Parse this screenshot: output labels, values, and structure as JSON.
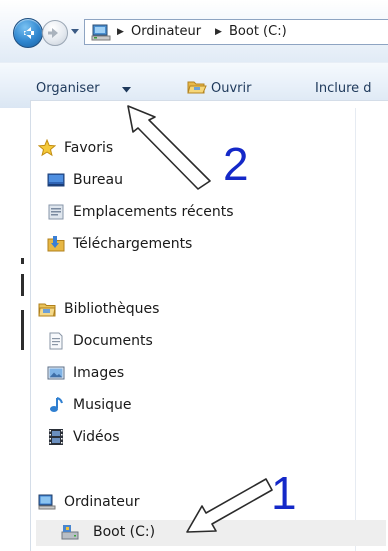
{
  "address_bar": {
    "crumbs": [
      "Ordinateur",
      "Boot (C:)"
    ]
  },
  "toolbar": {
    "organize_label": "Organiser",
    "open_label": "Ouvrir",
    "include_label": "Inclure d"
  },
  "nav": {
    "favorites": {
      "title": "Favoris",
      "items": [
        "Bureau",
        "Emplacements récents",
        "Téléchargements"
      ]
    },
    "libraries": {
      "title": "Bibliothèques",
      "items": [
        "Documents",
        "Images",
        "Musique",
        "Vidéos"
      ]
    },
    "computer": {
      "title": "Ordinateur",
      "items": [
        "Boot (C:)"
      ]
    }
  },
  "annotations": {
    "label_1": "1",
    "label_2": "2"
  },
  "colors": {
    "annotation": "#1428c8",
    "toolbar_text": "#1e395b",
    "selection": "#eeeeee"
  }
}
